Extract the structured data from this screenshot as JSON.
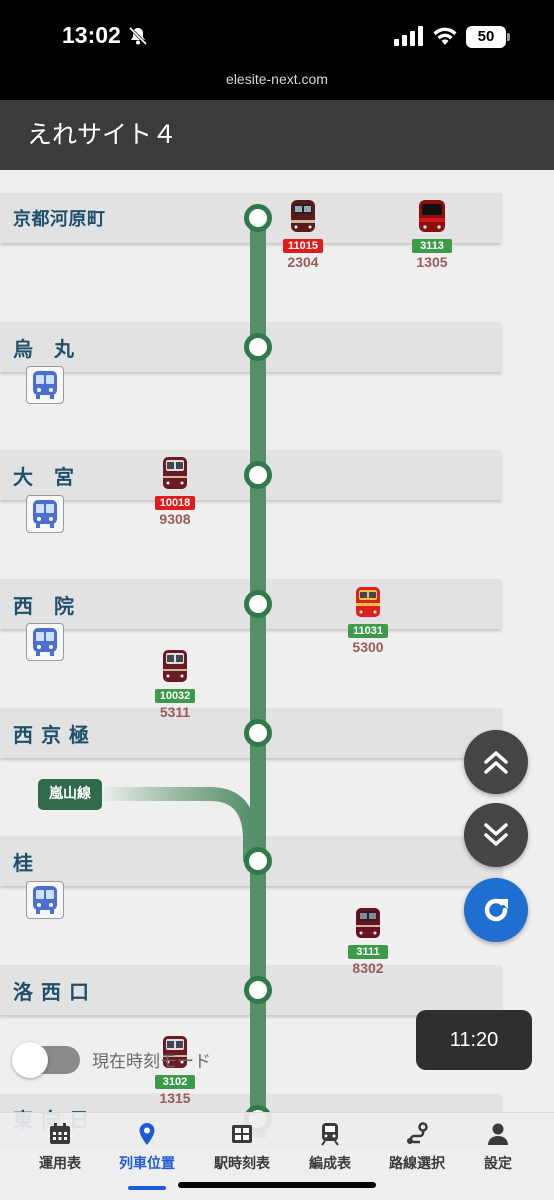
{
  "status_bar": {
    "time": "13:02",
    "battery": "50"
  },
  "url": "elesite-next.com",
  "app": {
    "title": "えれサイト４"
  },
  "stations": [
    {
      "name": "京都河原町"
    },
    {
      "name": "烏　丸"
    },
    {
      "name": "大　宮"
    },
    {
      "name": "西　院"
    },
    {
      "name": "西京極"
    },
    {
      "name": "桂"
    },
    {
      "name": "洛西口"
    },
    {
      "name": "東向日"
    }
  ],
  "branch": {
    "label": "嵐山線"
  },
  "trains": [
    {
      "badge": "11015",
      "badge_color": "red",
      "number": "2304"
    },
    {
      "badge": "3113",
      "badge_color": "green",
      "number": "1305"
    },
    {
      "badge": "10018",
      "badge_color": "red",
      "number": "9308"
    },
    {
      "badge": "11031",
      "badge_color": "green",
      "number": "5300"
    },
    {
      "badge": "10032",
      "badge_color": "green",
      "number": "5311"
    },
    {
      "badge": "3111",
      "badge_color": "green",
      "number": "8302"
    },
    {
      "badge": "3102",
      "badge_color": "green",
      "number": "1315"
    }
  ],
  "clock": "11:20",
  "toggle": {
    "label": "現在時刻モード",
    "on": false
  },
  "nav": [
    {
      "label": "運用表",
      "icon": "calendar-icon"
    },
    {
      "label": "列車位置",
      "icon": "location-pin-icon",
      "active": true
    },
    {
      "label": "駅時刻表",
      "icon": "table-grid-icon"
    },
    {
      "label": "編成表",
      "icon": "train-icon"
    },
    {
      "label": "路線選択",
      "icon": "route-icon"
    },
    {
      "label": "設定",
      "icon": "person-icon"
    }
  ],
  "colors": {
    "line_green": "#56906a",
    "node_border": "#2f7a4a",
    "station_text": "#1f4f6c",
    "badge_red": "#e11b1b",
    "badge_green": "#3d9a4a",
    "nav_active": "#1f5bd6",
    "refresh_blue": "#1e6fd0"
  }
}
